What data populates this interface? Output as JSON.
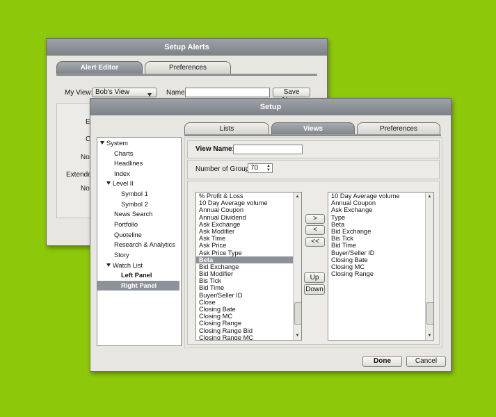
{
  "alerts_window": {
    "title": "Setup Alerts",
    "tabs": [
      {
        "label": "Alert Editor"
      },
      {
        "label": "Preferences"
      }
    ],
    "my_view_label": "My View:",
    "my_view_value": "Bob's View",
    "name_label": "Name:",
    "name_value": "",
    "save_name_label": "Save Name",
    "side_labels": [
      "En",
      "Co",
      "Noti",
      "Extende",
      "Noti"
    ]
  },
  "setup_window": {
    "title": "Setup",
    "tabs": [
      {
        "label": "Lists"
      },
      {
        "label": "Views"
      },
      {
        "label": "Preferences"
      }
    ],
    "active_tab": "Views",
    "tree": [
      {
        "label": "System",
        "expanded": true
      },
      {
        "label": "Charts"
      },
      {
        "label": "Headlines"
      },
      {
        "label": "Index"
      },
      {
        "label": "Level II",
        "expanded": true
      },
      {
        "label": "Symbol 1"
      },
      {
        "label": "Symbol 2"
      },
      {
        "label": "News Search"
      },
      {
        "label": "Portfolio"
      },
      {
        "label": "Quoteline"
      },
      {
        "label": "Research & Analytics"
      },
      {
        "label": "Story"
      },
      {
        "label": "Watch List",
        "expanded": true
      },
      {
        "label": "Left Panel"
      },
      {
        "label": "Right Panel",
        "selected": true
      }
    ],
    "view_name_label": "View Name:",
    "view_name_value": "",
    "groups_label": "Number of Groups:",
    "groups_value": "70",
    "available_fields": [
      "% Profit & Loss",
      "10 Day Average volume",
      "Annual Coupon",
      "Annual Dividend",
      "Ask Exchange",
      "Ask Modifier",
      "Ask Time",
      "Ask Price",
      "Ask Price Type",
      "Beta",
      "Bid Exchange",
      "Bid Modifier",
      "Bis Tick",
      "Bid Time",
      "Buyer/Seller ID",
      "Close",
      "Closing Bate",
      "Closing MC",
      "Closing Range",
      "Closing Range Bid",
      "Closing Range MC"
    ],
    "available_selected": "Beta",
    "selected_fields": [
      "10 Day Average volume",
      "Annual Coupon",
      "Ask Exchange",
      "Type",
      "Beta",
      "Bid Exchange",
      "Bis Tick",
      "Bid Time",
      "Buyer/Seller ID",
      "Closing Bate",
      "Closing MC",
      "Closing Range"
    ],
    "move_buttons": {
      "add": ">",
      "remove": "<",
      "remove_all": "<<",
      "up": "Up",
      "down": "Down"
    },
    "done_label": "Done",
    "cancel_label": "Cancel"
  }
}
